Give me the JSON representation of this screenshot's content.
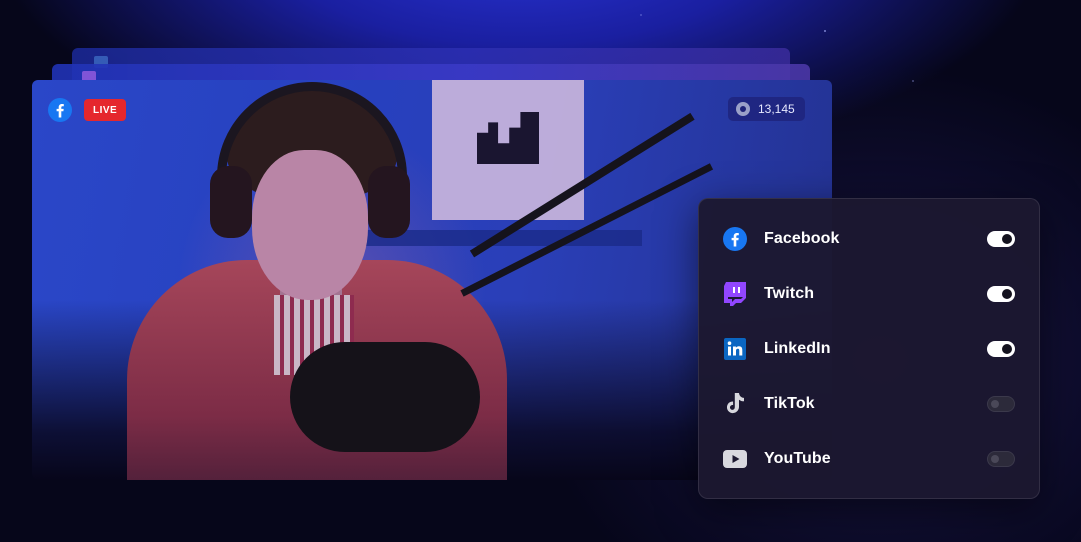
{
  "stream": {
    "status_label": "LIVE",
    "viewer_count": "13,145",
    "platform_icon": "facebook-icon"
  },
  "destinations": {
    "items": [
      {
        "label": "Facebook",
        "icon": "facebook-icon",
        "enabled": true
      },
      {
        "label": "Twitch",
        "icon": "twitch-icon",
        "enabled": true
      },
      {
        "label": "LinkedIn",
        "icon": "linkedin-icon",
        "enabled": true
      },
      {
        "label": "TikTok",
        "icon": "tiktok-icon",
        "enabled": false
      },
      {
        "label": "YouTube",
        "icon": "youtube-icon",
        "enabled": false
      }
    ]
  },
  "colors": {
    "live_red": "#e5272d",
    "facebook_blue": "#1877f2",
    "twitch_purple": "#9146ff",
    "linkedin_blue": "#0a66c2",
    "panel_bg": "#1c1830"
  }
}
